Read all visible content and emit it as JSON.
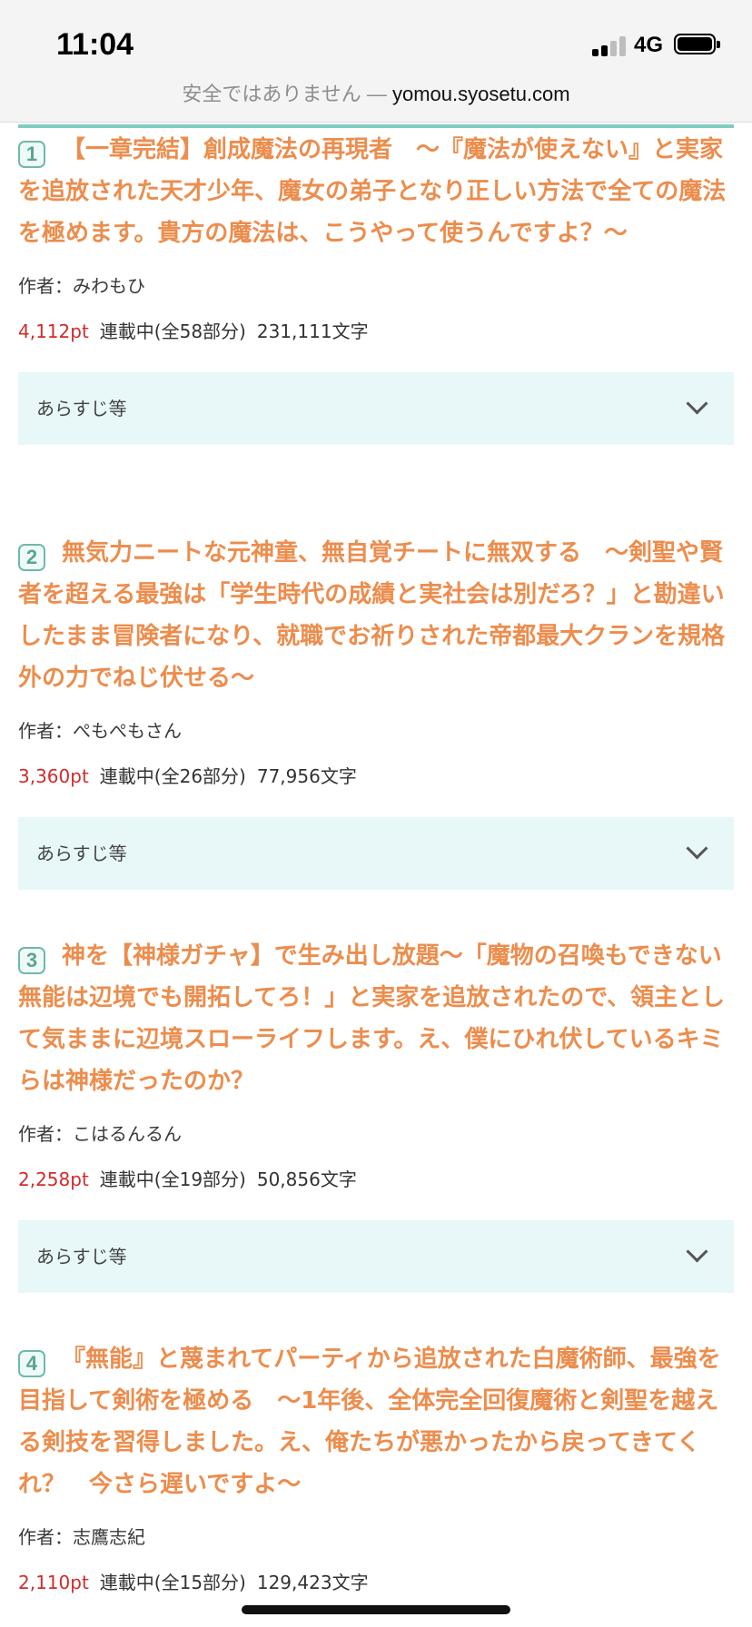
{
  "status_bar": {
    "time": "11:04",
    "network": "4G"
  },
  "url_bar": {
    "insecure_label": "安全ではありません —",
    "domain": "yomou.syosetu.com"
  },
  "entries": [
    {
      "rank": "1",
      "title": "【一章完結】創成魔法の再現者　〜『魔法が使えない』と実家を追放された天才少年、魔女の弟子となり正しい方法で全ての魔法を極めます。貴方の魔法は、こうやって使うんですよ？〜",
      "author": "作者：みわもひ",
      "points": "4,112pt",
      "status": "連載中(全58部分)",
      "chars": "231,111文字",
      "synopsis_label": "あらすじ等"
    },
    {
      "rank": "2",
      "title": "無気力ニートな元神童、無自覚チートに無双する　〜剣聖や賢者を超える最強は「学生時代の成績と実社会は別だろ？」と勘違いしたまま冒険者になり、就職でお祈りされた帝都最大クランを規格外の力でねじ伏せる〜",
      "author": "作者：ぺもぺもさん",
      "points": "3,360pt",
      "status": "連載中(全26部分)",
      "chars": "77,956文字",
      "synopsis_label": "あらすじ等"
    },
    {
      "rank": "3",
      "title": "神を【神様ガチャ】で生み出し放題〜「魔物の召喚もできない無能は辺境でも開拓してろ！」と実家を追放されたので、領主として気ままに辺境スローライフします。え、僕にひれ伏しているキミらは神様だったのか？",
      "author": "作者：こはるんるん",
      "points": "2,258pt",
      "status": "連載中(全19部分)",
      "chars": "50,856文字",
      "synopsis_label": "あらすじ等"
    },
    {
      "rank": "4",
      "title": "『無能』と蔑まれてパーティから追放された白魔術師、最強を目指して剣術を極める　〜1年後、全体完全回復魔術と剣聖を越える剣技を習得しました。え、俺たちが悪かったから戻ってきてくれ？　今さら遅いですよ〜",
      "author": "作者：志鷹志紀",
      "points": "2,110pt",
      "status": "連載中(全15部分)",
      "chars": "129,423文字"
    }
  ]
}
